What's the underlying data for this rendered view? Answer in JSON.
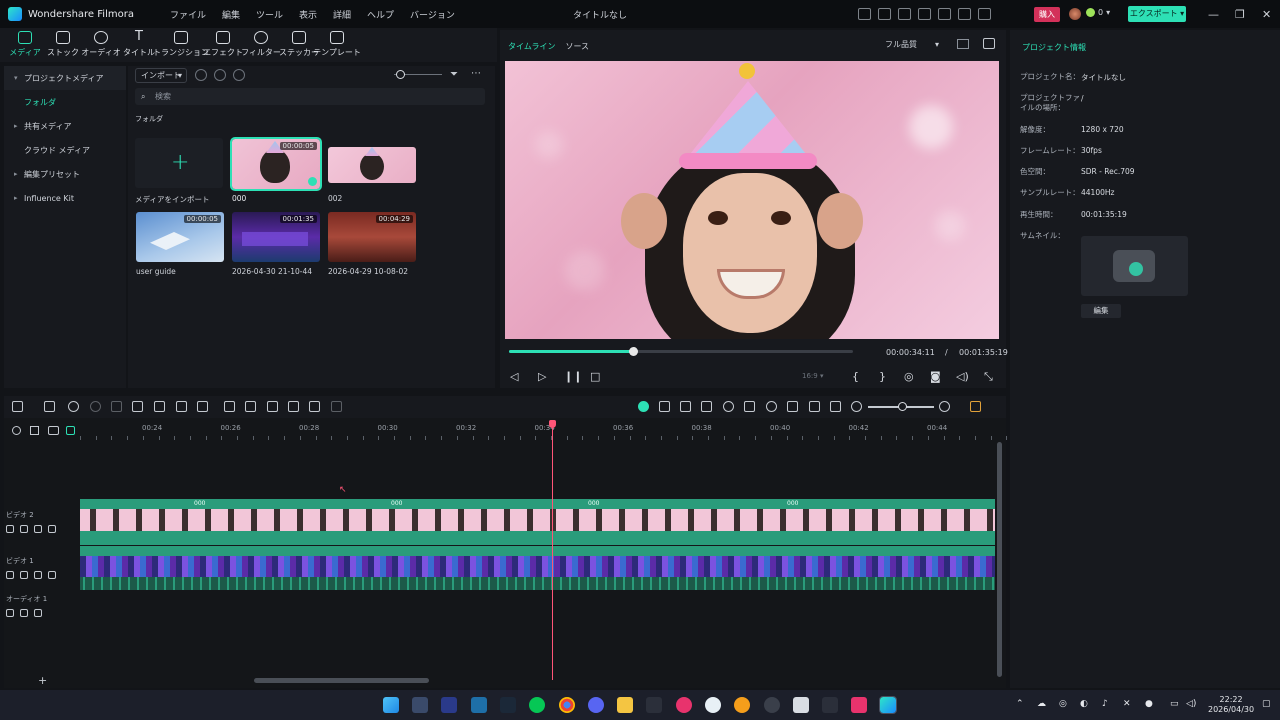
{
  "app": {
    "name": "Wondershare Filmora",
    "menu": [
      "ファイル",
      "編集",
      "ツール",
      "表示",
      "詳細",
      "ヘルプ",
      "バージョン"
    ],
    "doc_title": "タイトルなし",
    "buy_label": "購入",
    "credits": "0",
    "export_label": "エクスポート"
  },
  "toolbar": {
    "tabs": [
      "メディア",
      "ストック",
      "オーディオ",
      "タイトル",
      "トランジション",
      "エフェクト",
      "フィルター",
      "ステッカー",
      "テンプレート"
    ]
  },
  "media": {
    "sidebar": [
      "プロジェクトメディア",
      "フォルダ",
      "共有メディア",
      "クラウド メディア",
      "編集プリセット",
      "Influence Kit"
    ],
    "import_label": "インポート",
    "search_placeholder": "検索",
    "folder_label": "フォルダ",
    "import_tile_label": "メディアをインポート",
    "items": [
      {
        "name": "000",
        "duration": "00:00:05"
      },
      {
        "name": "002",
        "duration": ""
      },
      {
        "name": "user guide",
        "duration": "00:00:05"
      },
      {
        "name": "2026-04-30 21-10-44",
        "duration": "00:01:35"
      },
      {
        "name": "2026-04-29 10-08-02",
        "duration": "00:04:29"
      }
    ]
  },
  "preview": {
    "tab_timeline": "タイムライン",
    "tab_source": "ソース",
    "quality": "フル品質",
    "current_time": "00:00:34:11",
    "separator": "/",
    "total_time": "00:01:35:19",
    "aspect": "16:9",
    "progress": 0.36
  },
  "project_info": {
    "title": "プロジェクト情報",
    "rows": [
      {
        "label": "プロジェクト名：",
        "value": "タイトルなし"
      },
      {
        "label": "プロジェクトファイルの場所：",
        "value": "/"
      },
      {
        "label": "解像度：",
        "value": "1280 x 720"
      },
      {
        "label": "フレームレート：",
        "value": "30fps"
      },
      {
        "label": "色空間：",
        "value": "SDR - Rec.709"
      },
      {
        "label": "サンプルレート：",
        "value": "44100Hz"
      },
      {
        "label": "再生時間：",
        "value": "00:01:35:19"
      },
      {
        "label": "サムネイル：",
        "value": ""
      }
    ],
    "edit_label": "編集"
  },
  "timeline": {
    "ticks": [
      "00:24",
      "00:26",
      "00:28",
      "00:30",
      "00:32",
      "00:34",
      "00:36",
      "00:38",
      "00:40",
      "00:42",
      "00:44"
    ],
    "tracks": [
      "ビデオ 2",
      "ビデオ 1",
      "オーディオ 1"
    ],
    "clip_label": "000"
  },
  "taskbar": {
    "time": "22:22",
    "date": "2026/04/30"
  },
  "colors": {
    "accent": "#2de0b5",
    "playhead": "#ff5577",
    "buy": "#d3315a"
  }
}
